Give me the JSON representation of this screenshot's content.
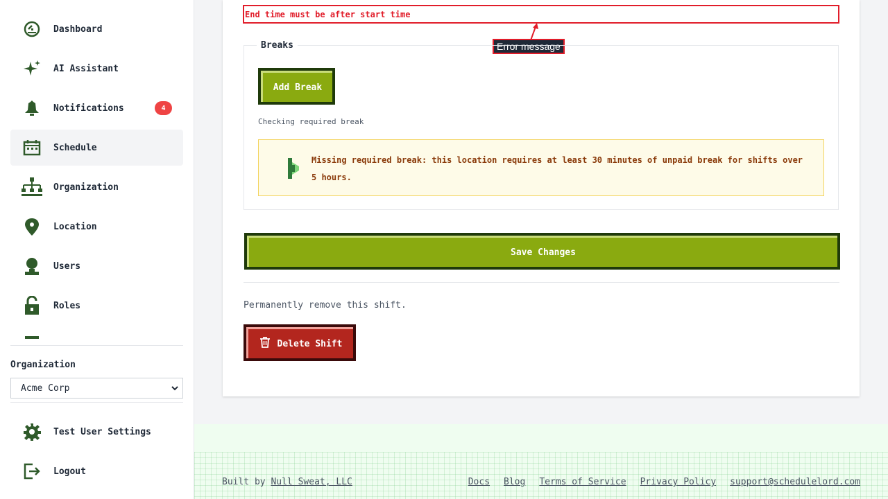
{
  "sidebar": {
    "items": [
      {
        "label": "Dashboard",
        "icon": "dashboard-icon"
      },
      {
        "label": "AI Assistant",
        "icon": "sparkle-icon"
      },
      {
        "label": "Notifications",
        "icon": "bell-icon",
        "badge": "4"
      },
      {
        "label": "Schedule",
        "icon": "calendar-icon",
        "active": true
      },
      {
        "label": "Organization",
        "icon": "org-chart-icon"
      },
      {
        "label": "Location",
        "icon": "map-pin-icon"
      },
      {
        "label": "Users",
        "icon": "user-icon"
      },
      {
        "label": "Roles",
        "icon": "lock-icon"
      }
    ],
    "org_label": "Organization",
    "org_selected": "Acme Corp",
    "settings_label": "Test User Settings",
    "logout_label": "Logout"
  },
  "form": {
    "error_text": "End time must be after start time",
    "annotation": "Error message",
    "breaks_legend": "Breaks",
    "add_break_label": "Add Break",
    "checking_text": "Checking required break",
    "warning_text": "Missing required break: this location requires at least 30 minutes of unpaid break for shifts over 5 hours.",
    "save_label": "Save Changes",
    "remove_text": "Permanently remove this shift.",
    "delete_label": "Delete Shift"
  },
  "footer": {
    "built_prefix": "Built by ",
    "built_link": "Null Sweat, LLC",
    "links": [
      "Docs",
      "Blog",
      "Terms of Service",
      "Privacy Policy",
      "support@schedulelord.com"
    ]
  },
  "colors": {
    "brand_green": "#8aaa10",
    "dark_green": "#1f3a0a",
    "icon_green": "#2f5a2a",
    "error_red": "#e11d2a",
    "delete_red": "#b3261e"
  }
}
